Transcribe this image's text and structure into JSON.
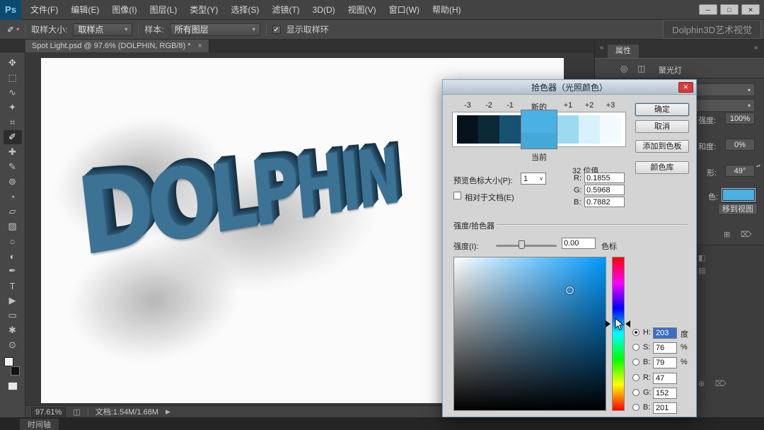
{
  "titlebar": {
    "logo": "Ps",
    "menus": [
      "文件(F)",
      "编辑(E)",
      "图像(I)",
      "图层(L)",
      "类型(Y)",
      "选择(S)",
      "滤镜(T)",
      "3D(D)",
      "视图(V)",
      "窗口(W)",
      "帮助(H)"
    ],
    "window": {
      "minimize": "─",
      "maximize": "□",
      "close": "✕"
    }
  },
  "options": {
    "tool_glyph": "✐",
    "arrow": "▾",
    "sample_size_label": "取样大小:",
    "sample_size_value": "取样点",
    "sample_label": "样本:",
    "sample_value": "所有图层",
    "check_glyph": "✓",
    "show_ring_label": "显示取样环",
    "watermark": "Dolphin3D艺术视觉"
  },
  "doc": {
    "tab": "Spot Light.psd @ 97.6% (DOLPHIN, RGB/8) *",
    "tab_close": "×",
    "canvas_word": "DOLPHIN",
    "zoom": "97.61%",
    "doc_icon": "◫",
    "size": "文档:1.54M/1.68M",
    "status_arrow": "▶"
  },
  "toolbar": {
    "tools": [
      {
        "name": "move-tool",
        "glyph": "✥"
      },
      {
        "name": "marquee-tool",
        "glyph": "⬚"
      },
      {
        "name": "lasso-tool",
        "glyph": "∿"
      },
      {
        "name": "quick-select-tool",
        "glyph": "✦"
      },
      {
        "name": "crop-tool",
        "glyph": "⌗"
      },
      {
        "name": "eyedropper-tool",
        "glyph": "✐"
      },
      {
        "name": "healing-brush-tool",
        "glyph": "✚"
      },
      {
        "name": "brush-tool",
        "glyph": "✎"
      },
      {
        "name": "clone-stamp-tool",
        "glyph": "⊚"
      },
      {
        "name": "history-brush-tool",
        "glyph": "◔"
      },
      {
        "name": "eraser-tool",
        "glyph": "▱"
      },
      {
        "name": "gradient-tool",
        "glyph": "▨"
      },
      {
        "name": "blur-tool",
        "glyph": "○"
      },
      {
        "name": "dodge-tool",
        "glyph": "◐"
      },
      {
        "name": "pen-tool",
        "glyph": "✒"
      },
      {
        "name": "type-tool",
        "glyph": "T"
      },
      {
        "name": "path-select-tool",
        "glyph": "▶"
      },
      {
        "name": "shape-tool",
        "glyph": "▭"
      },
      {
        "name": "hand-tool",
        "glyph": "✱"
      },
      {
        "name": "zoom-tool",
        "glyph": "⊙"
      }
    ]
  },
  "right": {
    "collapse_left": "«",
    "collapse_right": "«",
    "tab": "属性",
    "icon_eye": "◎",
    "icon_cube": "◫",
    "light_label": "聚光灯",
    "dd_arrow": "▾",
    "rows": [
      {
        "label": "强度:",
        "value": "100%"
      },
      {
        "label": "和度:",
        "value": "0%"
      },
      {
        "label": "形:",
        "value": "49°"
      }
    ],
    "stepper": "▴▾",
    "color_label": "色:",
    "swatch_color": "#4cb0e0",
    "move_btn": "移到视图",
    "icon_grid": "⊞",
    "icon_trash": "⌦",
    "lower_icon_1": "◧",
    "lower_icon_2": "▤",
    "lower_icon_3": "⊕",
    "lower_icon_4": "⌦"
  },
  "timeline": {
    "tab": "时间轴"
  },
  "dialog": {
    "title": "拾色器（光照颜色）",
    "close": "✕",
    "stops": [
      {
        "label": "-3",
        "color": "#05121b"
      },
      {
        "label": "-2",
        "color": "#0b2836"
      },
      {
        "label": "-1",
        "color": "#175273"
      },
      {
        "label": "新的",
        "color": "#4ab1e2"
      },
      {
        "label": "+1",
        "color": "#9ddaf2"
      },
      {
        "label": "+2",
        "color": "#d8f2fb"
      },
      {
        "label": "+3",
        "color": "#f3fbff"
      }
    ],
    "current_label": "当前",
    "current_color": "#45a9d8",
    "ok": "确定",
    "cancel": "取消",
    "add": "添加到色板",
    "lib": "颜色库",
    "bits": "32 位值",
    "preview_label": "预览色标大小(P):",
    "preview_value": "1",
    "preview_arrow": "∨",
    "relative_label": "相对于文档(E)",
    "f32": {
      "r_label": "R:",
      "r": "0.1855",
      "g_label": "G:",
      "g": "0.5968",
      "b_label": "B:",
      "b": "0.7882"
    },
    "section": "强度/拾色器",
    "intensity_label": "强度(I):",
    "intensity_value": "0.00",
    "stop_word": "色标",
    "field_hue": "#0099ff",
    "hsb": [
      {
        "label": "H:",
        "value": "203",
        "unit": "度"
      },
      {
        "label": "S:",
        "value": "76",
        "unit": "%"
      },
      {
        "label": "B:",
        "value": "79",
        "unit": "%"
      }
    ],
    "rgb": [
      {
        "label": "R:",
        "value": "47"
      },
      {
        "label": "G:",
        "value": "152"
      },
      {
        "label": "B:",
        "value": "201"
      }
    ]
  }
}
